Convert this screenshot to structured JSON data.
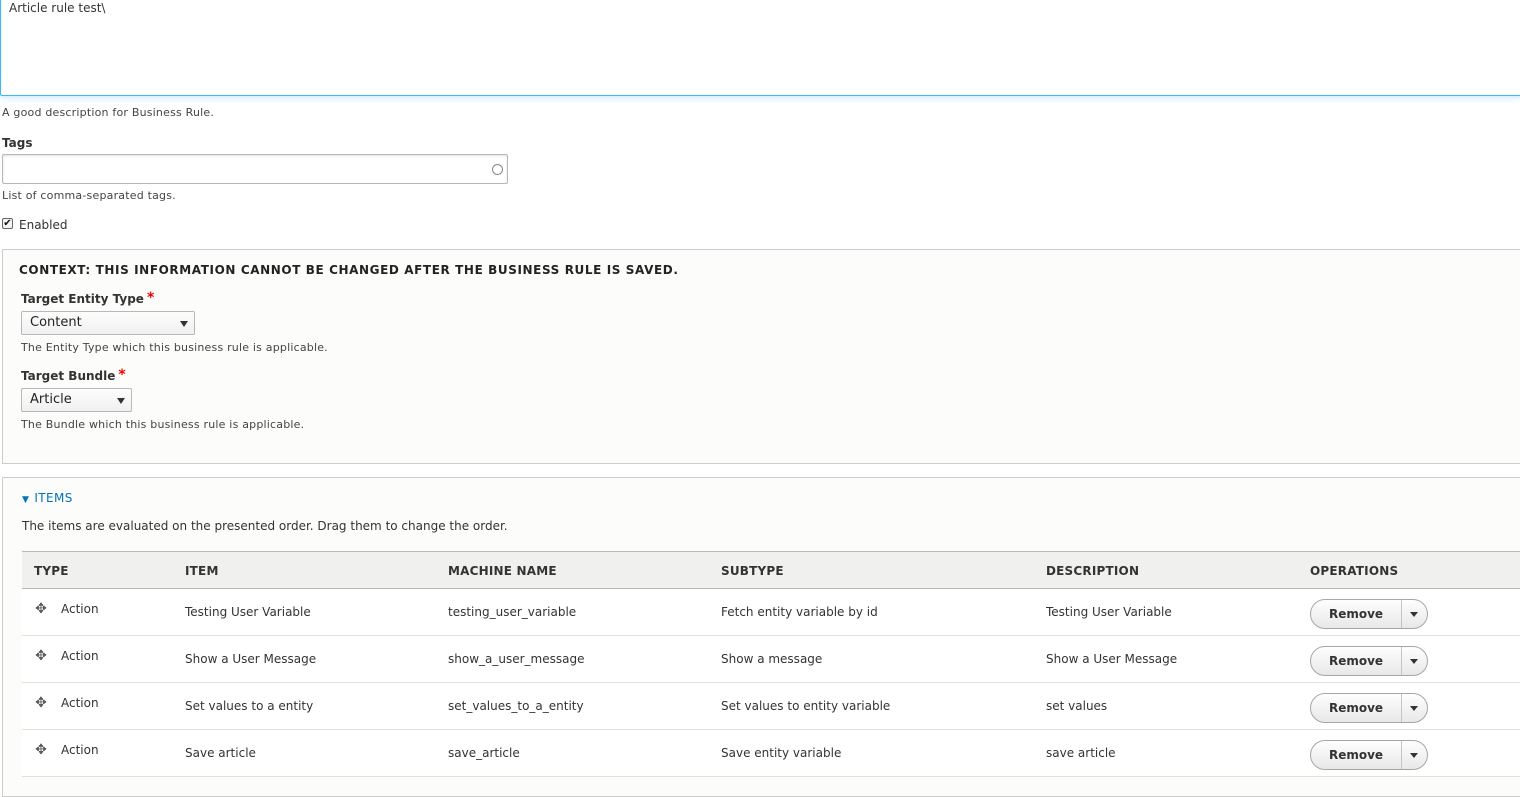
{
  "description": {
    "value": "Article rule test\\",
    "help": "A good description for Business Rule."
  },
  "tags": {
    "label": "Tags",
    "value": "",
    "help": "List of comma-separated tags."
  },
  "enabled": {
    "label": "Enabled",
    "checked": true,
    "check_glyph": "✔"
  },
  "context": {
    "legend": "CONTEXT: THIS INFORMATION CANNOT BE CHANGED AFTER THE BUSINESS RULE IS SAVED.",
    "required_marker": "*",
    "entity_type": {
      "label": "Target Entity Type",
      "selected": "Content",
      "help": "The Entity Type which this business rule is applicable."
    },
    "bundle": {
      "label": "Target Bundle",
      "selected": "Article",
      "help": "The Bundle which this business rule is applicable."
    }
  },
  "items": {
    "title": "ITEMS",
    "toggle_glyph": "▼",
    "description": "The items are evaluated on the presented order. Drag them to change the order.",
    "columns": [
      "TYPE",
      "ITEM",
      "MACHINE NAME",
      "SUBTYPE",
      "DESCRIPTION",
      "OPERATIONS"
    ],
    "drag_glyph": "✥",
    "rows": [
      {
        "type": "Action",
        "item": "Testing User Variable",
        "machine_name": "testing_user_variable",
        "subtype": "Fetch entity variable by id",
        "description": "Testing User Variable",
        "operation": "Remove"
      },
      {
        "type": "Action",
        "item": "Show a User Message",
        "machine_name": "show_a_user_message",
        "subtype": "Show a message",
        "description": "Show a User Message",
        "operation": "Remove"
      },
      {
        "type": "Action",
        "item": "Set values to a entity",
        "machine_name": "set_values_to_a_entity",
        "subtype": "Set values to entity variable",
        "description": "set values",
        "operation": "Remove"
      },
      {
        "type": "Action",
        "item": "Save article",
        "machine_name": "save_article",
        "subtype": "Save entity variable",
        "description": "save article",
        "operation": "Remove"
      }
    ]
  },
  "colors": {
    "focus_border": "#40b6ff",
    "link": "#0074bd",
    "required": "#ee0000"
  }
}
